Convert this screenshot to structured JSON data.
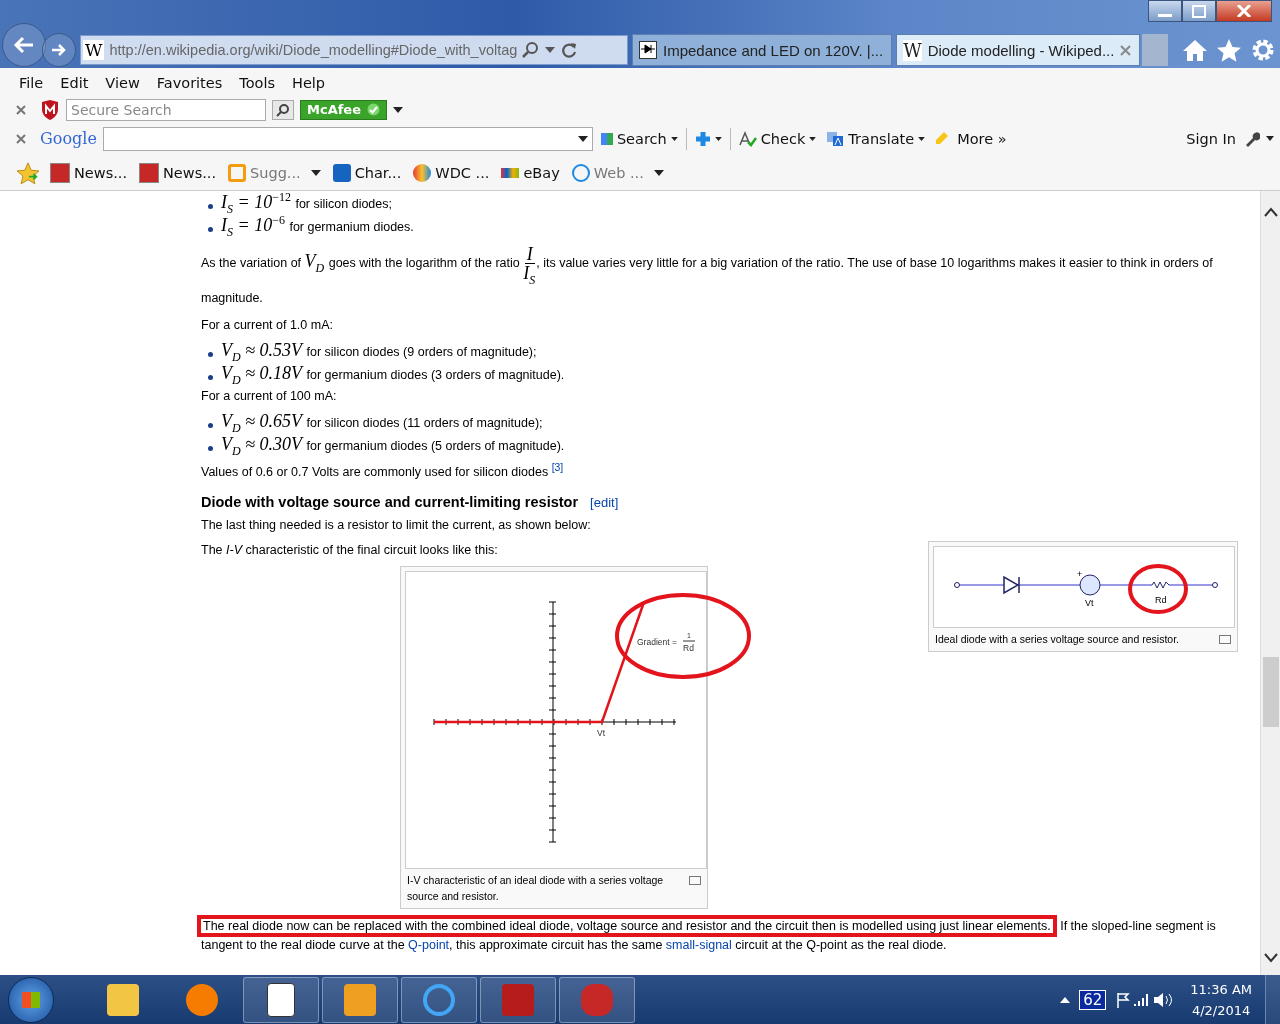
{
  "browser": {
    "site_icon": "W",
    "url": "http://en.wikipedia.org/wiki/Diode_modelling#Diode_with_voltag",
    "tabs": [
      {
        "title": "Impedance and LED on 120V. |...",
        "selected": false
      },
      {
        "title": "Diode modelling - Wikiped...",
        "selected": true,
        "icon": "W"
      }
    ],
    "menu": [
      "File",
      "Edit",
      "View",
      "Favorites",
      "Tools",
      "Help"
    ],
    "mcafee": {
      "placeholder": "Secure Search",
      "brand": "McAfee"
    },
    "google": {
      "brand": "Google",
      "search": "Search",
      "check": "Check",
      "translate": "Translate",
      "more": "More »",
      "sign_in": "Sign In"
    },
    "favorites": [
      {
        "label": "News...",
        "dropdown": false,
        "kind": "news"
      },
      {
        "label": "News...",
        "dropdown": false,
        "kind": "news"
      },
      {
        "label": "Sugg...",
        "dropdown": true,
        "kind": "suggest"
      },
      {
        "label": "Char...",
        "dropdown": false,
        "kind": "chat"
      },
      {
        "label": "WDC ...",
        "dropdown": false,
        "kind": "wdc"
      },
      {
        "label": "eBay",
        "dropdown": false,
        "kind": "ebay"
      },
      {
        "label": "Web ...",
        "dropdown": true,
        "kind": "web"
      }
    ]
  },
  "article": {
    "list_1": [
      {
        "math": "I$_{S}$ = 10$^{−12}$",
        "text": "for silicon diodes;"
      },
      {
        "math": "I$_{S}$ = 10$^{−6}$",
        "text": "for germanium diodes."
      }
    ],
    "ratio_para": {
      "before": "As the variation of",
      "vd": "V$_{D}$",
      "middle": "goes with the logarithm of the ratio",
      "numerator": "I",
      "denominator": "I$_{S}$",
      "after": ", its value varies very little for a big variation of the ratio. The use of base 10 logarithms makes it easier to think in orders of magnitude."
    },
    "current_1": "For a current of 1.0 mA:",
    "list_2": [
      {
        "math": "V$_{D}$ ≈ 0.53V",
        "text": "for silicon diodes (9 orders of magnitude);"
      },
      {
        "math": "V$_{D}$ ≈ 0.18V",
        "text": "for germanium diodes (3 orders of magnitude)."
      }
    ],
    "current_2": "For a current of 100 mA:",
    "list_3": [
      {
        "math": "V$_{D}$ ≈ 0.65V",
        "text": "for silicon diodes (11 orders of magnitude);"
      },
      {
        "math": "V$_{D}$ ≈ 0.30V",
        "text": "for germanium diodes (5 orders of magnitude)."
      }
    ],
    "values_para": {
      "text": "Values of 0.6 or 0.7 Volts are commonly used for silicon diodes",
      "citation": "[3]"
    },
    "heading": "Diode with voltage source and current-limiting resistor",
    "edit": "[edit]",
    "para_1": "The last thing needed is a resistor to limit the current, as shown below:",
    "para_2": "The *I-V* characteristic of the final circuit looks like this:",
    "graph": {
      "gradient_label": "Gradient =",
      "numerator": "1",
      "denominator": "Rd",
      "vt_label": "Vt",
      "caption": "I-V characteristic of an ideal diode with a series voltage source and resistor."
    },
    "circuit": {
      "plus": "+",
      "vt_label": "Vt",
      "rd_label": "Rd",
      "caption": "Ideal diode with a series voltage source and resistor."
    },
    "final_para": {
      "highlighted": "The real diode now can be replaced with the combined ideal diode, voltage source and resistor and the circuit then is modelled using just linear elements.",
      "text_1": "If the sloped-line segment is tangent to the real diode curve at the",
      "link_1": "Q-point",
      "text_2": ", this approximate circuit has the same",
      "link_2": "small-signal",
      "text_3": "circuit at the Q-point as the real diode."
    }
  },
  "taskbar": {
    "apps": [
      {
        "kind": "folder",
        "active": false
      },
      {
        "kind": "media",
        "active": false
      },
      {
        "kind": "cards",
        "active": true
      },
      {
        "kind": "outlook",
        "active": true
      },
      {
        "kind": "ie",
        "active": true
      },
      {
        "kind": "pdf",
        "active": true
      },
      {
        "kind": "app",
        "active": true
      }
    ],
    "badge": "62",
    "time": "11:36 AM",
    "date": "4/2/2014"
  }
}
